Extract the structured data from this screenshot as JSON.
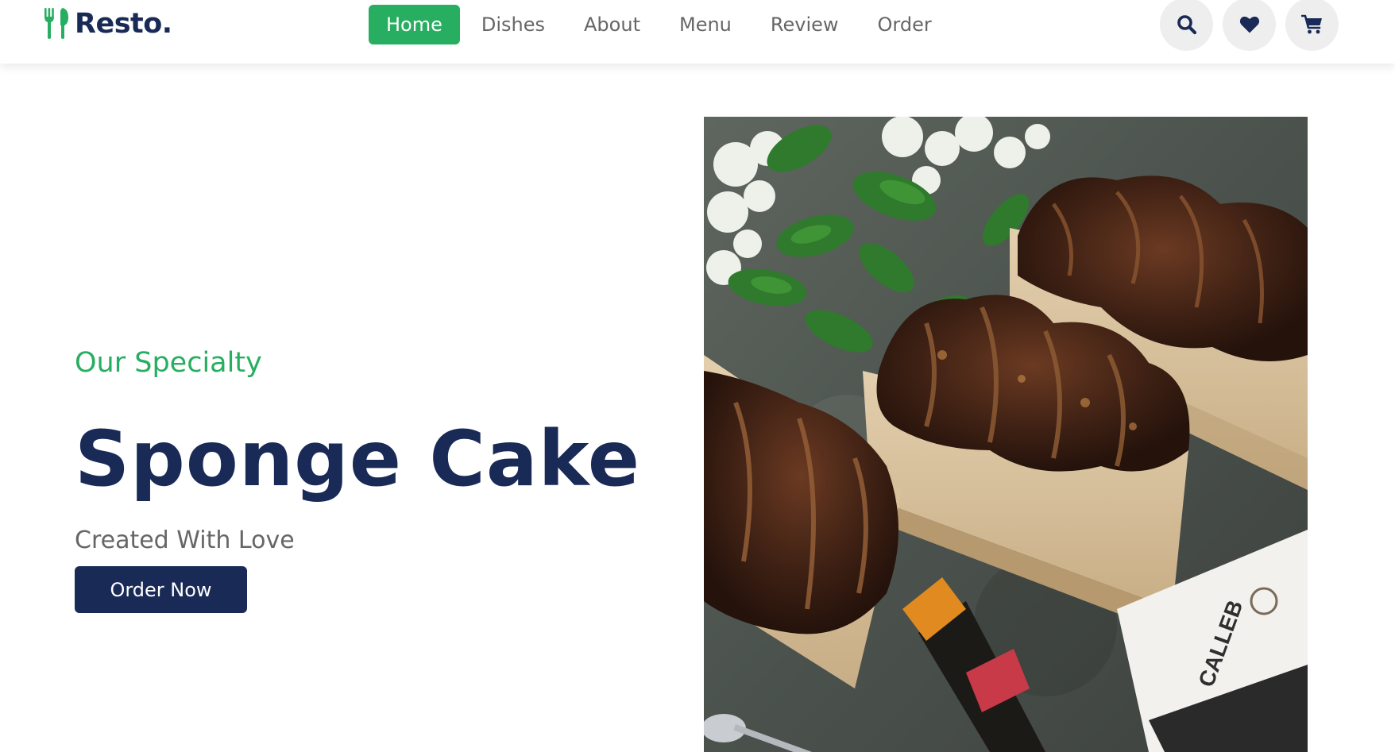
{
  "brand": {
    "name": "Resto.",
    "icon": "utensils-icon",
    "color": "#192a56",
    "accent": "#27ae60"
  },
  "nav": {
    "items": [
      {
        "label": "Home",
        "active": true
      },
      {
        "label": "Dishes",
        "active": false
      },
      {
        "label": "About",
        "active": false
      },
      {
        "label": "Menu",
        "active": false
      },
      {
        "label": "Review",
        "active": false
      },
      {
        "label": "Order",
        "active": false
      }
    ]
  },
  "header_icons": [
    "search-icon",
    "heart-icon",
    "cart-icon"
  ],
  "hero": {
    "subtitle": "Our Specialty",
    "title": "Sponge Cake",
    "tagline": "Created With Love",
    "button_label": "Order Now",
    "image_label": "CALLEB"
  },
  "colors": {
    "accent_green": "#27ae60",
    "navy": "#192a56",
    "text_gray": "#666666",
    "icon_bg": "#eeeeee"
  }
}
